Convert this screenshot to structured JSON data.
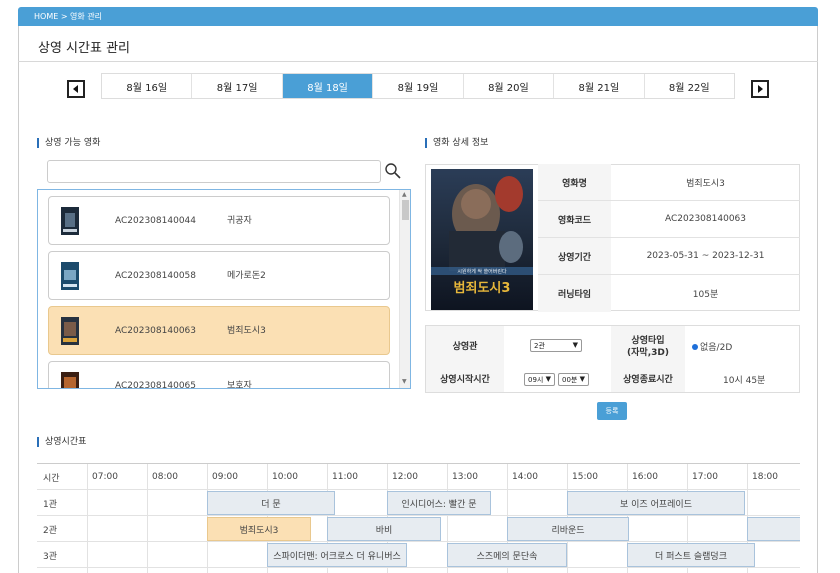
{
  "breadcrumb": "HOME > 영화 관리",
  "page_title": "상영 시간표 관리",
  "dates": [
    "8월 16일",
    "8월 17일",
    "8월 18일",
    "8월 19일",
    "8월 20일",
    "8월 21일",
    "8월 22일"
  ],
  "active_date": "8월 18일",
  "accent": "#4a9fd6",
  "available": {
    "title": "상영 가능 영화",
    "search_placeholder": "",
    "movies": [
      {
        "code": "AC202308140044",
        "name": "귀공자",
        "selected": false
      },
      {
        "code": "AC202308140058",
        "name": "메가로돈2",
        "selected": false
      },
      {
        "code": "AC202308140063",
        "name": "범죄도시3",
        "selected": true
      },
      {
        "code": "AC202308140065",
        "name": "보호자",
        "selected": false
      }
    ]
  },
  "detail": {
    "title": "영화 상세 정보",
    "rows": [
      {
        "label": "영화명",
        "value": "범죄도시3"
      },
      {
        "label": "영화코드",
        "value": "AC202308140063"
      },
      {
        "label": "상영기간",
        "value": "2023-05-31 ~ 2023-12-31"
      },
      {
        "label": "러닝타임",
        "value": "105분"
      }
    ],
    "poster_title": "범죄도시3"
  },
  "form": {
    "hall_label": "상영관",
    "hall_value": "2관",
    "type_label": "상영타입\n(자막,3D)",
    "type_value": "없음/2D",
    "start_label": "상영시작시간",
    "start_hour": "09시",
    "start_min": "00분",
    "end_label": "상영종료시간",
    "end_value": "10시 45분",
    "register_label": "등록"
  },
  "timetable": {
    "title": "상영시간표",
    "time_header": "시간",
    "hours": [
      "07:00",
      "08:00",
      "09:00",
      "10:00",
      "11:00",
      "12:00",
      "13:00",
      "14:00",
      "15:00",
      "16:00",
      "17:00",
      "18:00"
    ],
    "halls": [
      {
        "name": "1관",
        "shows": [
          {
            "title": "더 문"
          },
          {
            "title": "인시디어스: 빨간 문"
          },
          {
            "title": "보 이즈 어프레이드"
          }
        ]
      },
      {
        "name": "2관",
        "shows": [
          {
            "title": "범죄도시3"
          },
          {
            "title": "바비"
          },
          {
            "title": "리바운드"
          },
          {
            "title": ""
          }
        ]
      },
      {
        "name": "3관",
        "shows": [
          {
            "title": "스파이더맨: 어크로스 더 유니버스"
          },
          {
            "title": "스즈메의 문단속"
          },
          {
            "title": "더 퍼스트 슬램덩크"
          }
        ]
      }
    ]
  }
}
